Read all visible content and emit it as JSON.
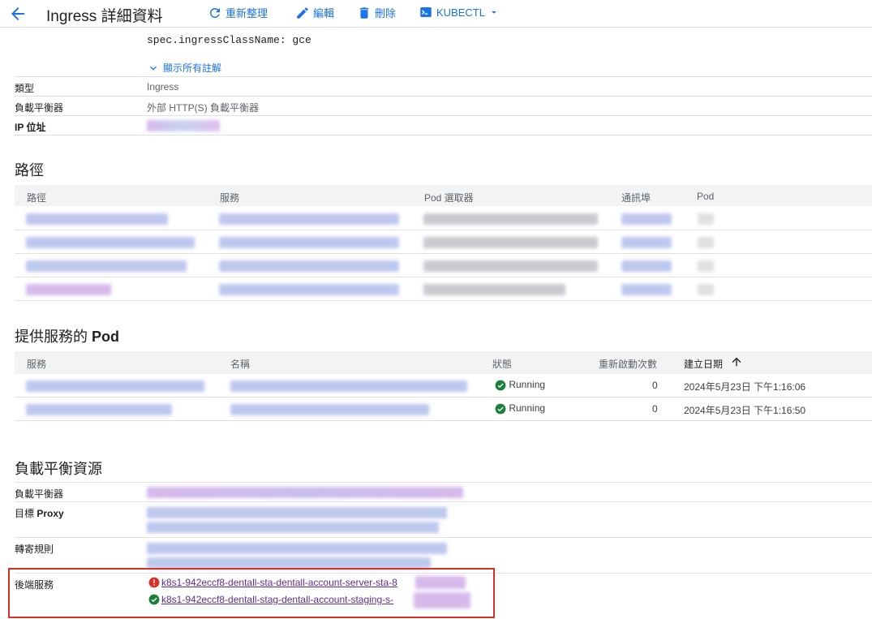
{
  "header": {
    "title": "Ingress 詳細資料",
    "refresh": "重新整理",
    "edit": "編輯",
    "delete": "刪除",
    "kubectl": "KUBECTL"
  },
  "annotations": {
    "spec_line": "spec.ingressClassName: gce",
    "show_all": "顯示所有註解"
  },
  "details": {
    "type_label": "類型",
    "type_value": "Ingress",
    "lb_label": "負載平衡器",
    "lb_value": "外部 HTTP(S) 負載平衡器",
    "ip_label": "IP 位址"
  },
  "paths": {
    "heading": "路徑",
    "columns": [
      "路徑",
      "服務",
      "Pod 選取器",
      "通訊埠",
      "Pod"
    ]
  },
  "pods": {
    "heading_prefix": "提供服務的 ",
    "heading_bold": "Pod",
    "columns": [
      "服務",
      "名稱",
      "狀態",
      "重新啟動次數",
      "建立日期"
    ],
    "rows": [
      {
        "status": "Running",
        "restarts": "0",
        "created": "2024年5月23日 下午1:16:06"
      },
      {
        "status": "Running",
        "restarts": "0",
        "created": "2024年5月23日 下午1:16:50"
      }
    ]
  },
  "lb_resources": {
    "heading": "負載平衡資源",
    "lb_label": "負載平衡器",
    "proxy_label_prefix": "目標 ",
    "proxy_label_bold": "Proxy",
    "forwarding_label": "轉寄規則",
    "backend_label": "後端服務",
    "backend_error": "k8s1-942eccf8-dentall-sta-dentall-account-server-sta-8",
    "backend_ok": "k8s1-942eccf8-dentall-stag-dentall-account-staging-s-"
  },
  "colors": {
    "accent": "#1a73e8",
    "success": "#188038",
    "error": "#d93025",
    "visited_link": "#5f2c91"
  }
}
